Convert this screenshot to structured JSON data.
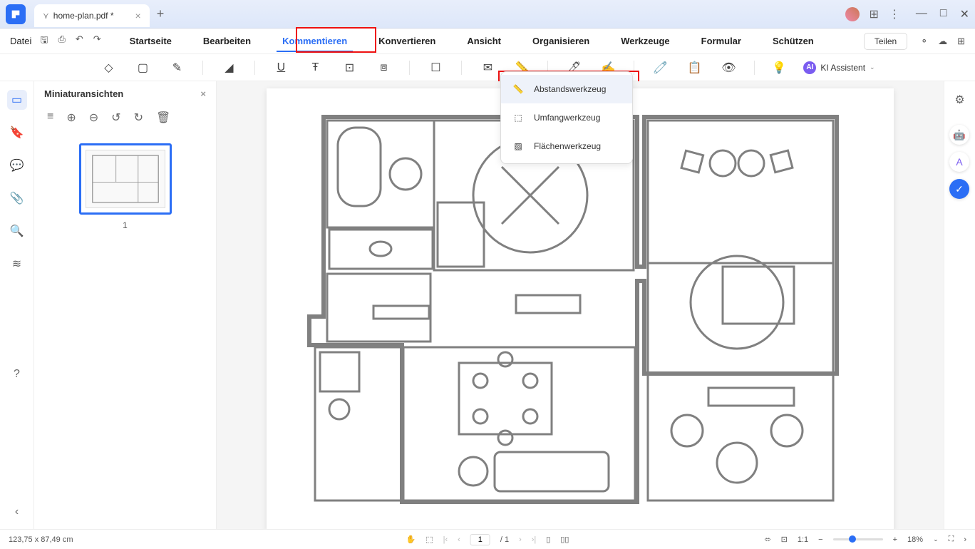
{
  "titlebar": {
    "filename": "home-plan.pdf *"
  },
  "menu": {
    "file": "Datei",
    "items": [
      "Startseite",
      "Bearbeiten",
      "Kommentieren",
      "Konvertieren",
      "Ansicht",
      "Organisieren",
      "Werkzeuge",
      "Formular",
      "Schützen"
    ],
    "active_index": 2,
    "teilen": "Teilen",
    "ai_label": "KI Assistent"
  },
  "dropdown": {
    "items": [
      {
        "label": "Abstandswerkzeug",
        "icon": "ruler"
      },
      {
        "label": "Umfangwerkzeug",
        "icon": "perimeter"
      },
      {
        "label": "Flächenwerkzeug",
        "icon": "area"
      }
    ],
    "hover_index": 0
  },
  "thumbnails": {
    "title": "Miniaturansichten",
    "pages": [
      {
        "number": "1"
      }
    ]
  },
  "statusbar": {
    "coords": "123,75 x 87,49 cm",
    "page_current": "1",
    "page_total": "/ 1",
    "zoom": "18%"
  }
}
